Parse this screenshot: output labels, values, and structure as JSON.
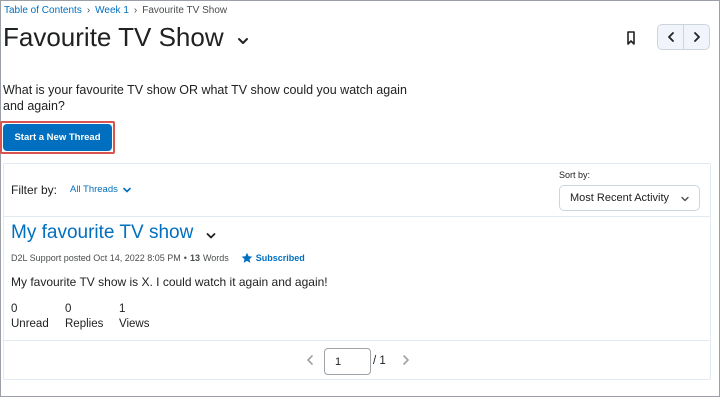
{
  "breadcrumb": {
    "items": [
      "Table of Contents",
      "Week 1"
    ],
    "current": "Favourite TV Show",
    "separator": "›"
  },
  "page": {
    "title": "Favourite TV Show",
    "description": "What is your favourite TV show OR what TV show could you watch again and again?",
    "start_thread_label": "Start a New Thread"
  },
  "icons": {
    "title_menu": "chevron-down-icon",
    "bookmark": "bookmark-icon",
    "previous": "chevron-left-icon",
    "next": "chevron-right-icon",
    "subscribed": "star-icon"
  },
  "filter": {
    "label": "Filter by:",
    "value": "All Threads"
  },
  "sort": {
    "label": "Sort by:",
    "value": "Most Recent Activity"
  },
  "thread": {
    "title": "My favourite TV show",
    "author_posted": "D2L Support posted Oct 14, 2022 8:05 PM",
    "dot": "•",
    "word_count": "13",
    "word_label": "Words",
    "subscribed_label": "Subscribed",
    "body": "My favourite TV show is X. I could watch it again and again!",
    "stats": [
      {
        "value": "0",
        "label": "Unread"
      },
      {
        "value": "0",
        "label": "Replies"
      },
      {
        "value": "1",
        "label": "Views"
      }
    ]
  },
  "pagination": {
    "current_page": "1",
    "total_label": "/ 1"
  },
  "colors": {
    "link": "#006fbf",
    "primary_button": "#006fbf",
    "highlight_border": "#d9534f"
  }
}
